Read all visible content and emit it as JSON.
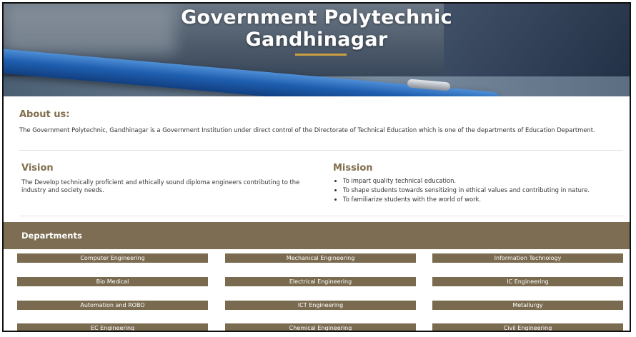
{
  "hero": {
    "title_line1": "Government Polytechnic",
    "title_line2": "Gandhinagar"
  },
  "about": {
    "heading": "About us:",
    "text": "The Government Polytechnic, Gandhinagar is a Government Institution under direct control of the Directorate of Technical Education which is one of the departments of Education Department."
  },
  "vision": {
    "heading": "Vision",
    "text": "The Develop technically proficient and ethically sound diploma engineers contributing to the industry and society needs."
  },
  "mission": {
    "heading": "Mission",
    "items": [
      "To impart quality technical education.",
      "To shape students towards sensitizing in ethical values and contributing in nature.",
      "To familiarize students with the world of work."
    ]
  },
  "departments": {
    "heading": "Departments",
    "items": [
      "Computer Engineering",
      "Mechanical Engineering",
      "Information Technology",
      "Bio Medical",
      "Electrical Engineering",
      "IC Engineering",
      "Automation and ROBO",
      "ICT Engineering",
      "Metallurgy",
      "EC Engineering",
      "Chemical Engineering",
      "Civil Engineering"
    ]
  },
  "colors": {
    "accent_brown": "#7d6e53",
    "heading_brown": "#806e4c",
    "underline_gold": "#c9a040"
  }
}
